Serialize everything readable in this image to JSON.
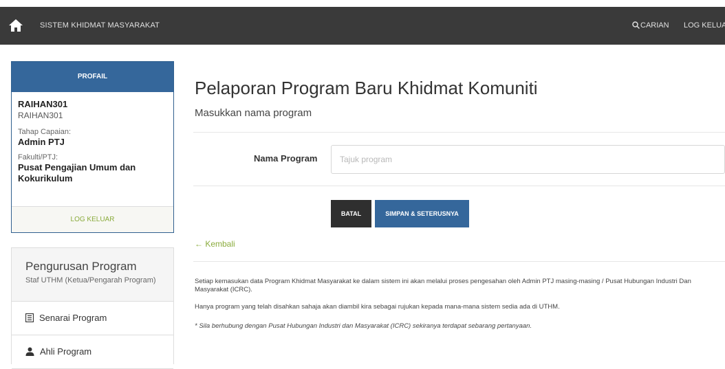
{
  "topbar": {
    "brand": "SISTEM KHIDMAT MASYARAKAT",
    "search_label": "CARIAN",
    "logout_label": "LOG KELUAR"
  },
  "profile": {
    "header": "PROFAIL",
    "username": "RAIHAN301",
    "username_sub": "RAIHAN301",
    "level_label": "Tahap Capaian:",
    "level_value": "Admin PTJ",
    "faculty_label": "Fakulti/PTJ:",
    "faculty_value": "Pusat Pengajian Umum dan Kokurikulum",
    "logout_label": "LOG KELUAR"
  },
  "program_panel": {
    "title": "Pengurusan Program",
    "subtitle": "Staf UTHM (Ketua/Pengarah Program)",
    "items": [
      {
        "label": "Senarai Program",
        "icon": "list-icon"
      },
      {
        "label": "Ahli Program",
        "icon": "user-icon"
      }
    ]
  },
  "main": {
    "title": "Pelaporan Program Baru Khidmat Komuniti",
    "subtitle": "Masukkan nama program",
    "form": {
      "program_name_label": "Nama Program",
      "program_name_value": "",
      "program_name_placeholder": "Tajuk program"
    },
    "cancel_label": "BATAL",
    "save_label": "SIMPAN & SETERUSNYA",
    "back_label": "← Kembali",
    "notes": [
      "Setiap kemasukan data Program Khidmat Masyarakat ke dalam sistem ini akan melalui proses pengesahan oleh Admin PTJ masing-masing / Pusat Hubungan Industri Dan Masyarakat (ICRC).",
      "Hanya program yang telah disahkan sahaja akan diambil kira sebagai rujukan kepada mana-mana sistem sedia ada di UTHM.",
      "* Sila berhubung dengan Pusat Hubungan Industri dan Masyarakat (ICRC) sekiranya terdapat sebarang pertanyaan."
    ]
  },
  "colors": {
    "topbar": "#3a3a3a",
    "primary": "#35679b",
    "accent_green": "#8aab3c",
    "dark_button": "#2f2f2f"
  }
}
